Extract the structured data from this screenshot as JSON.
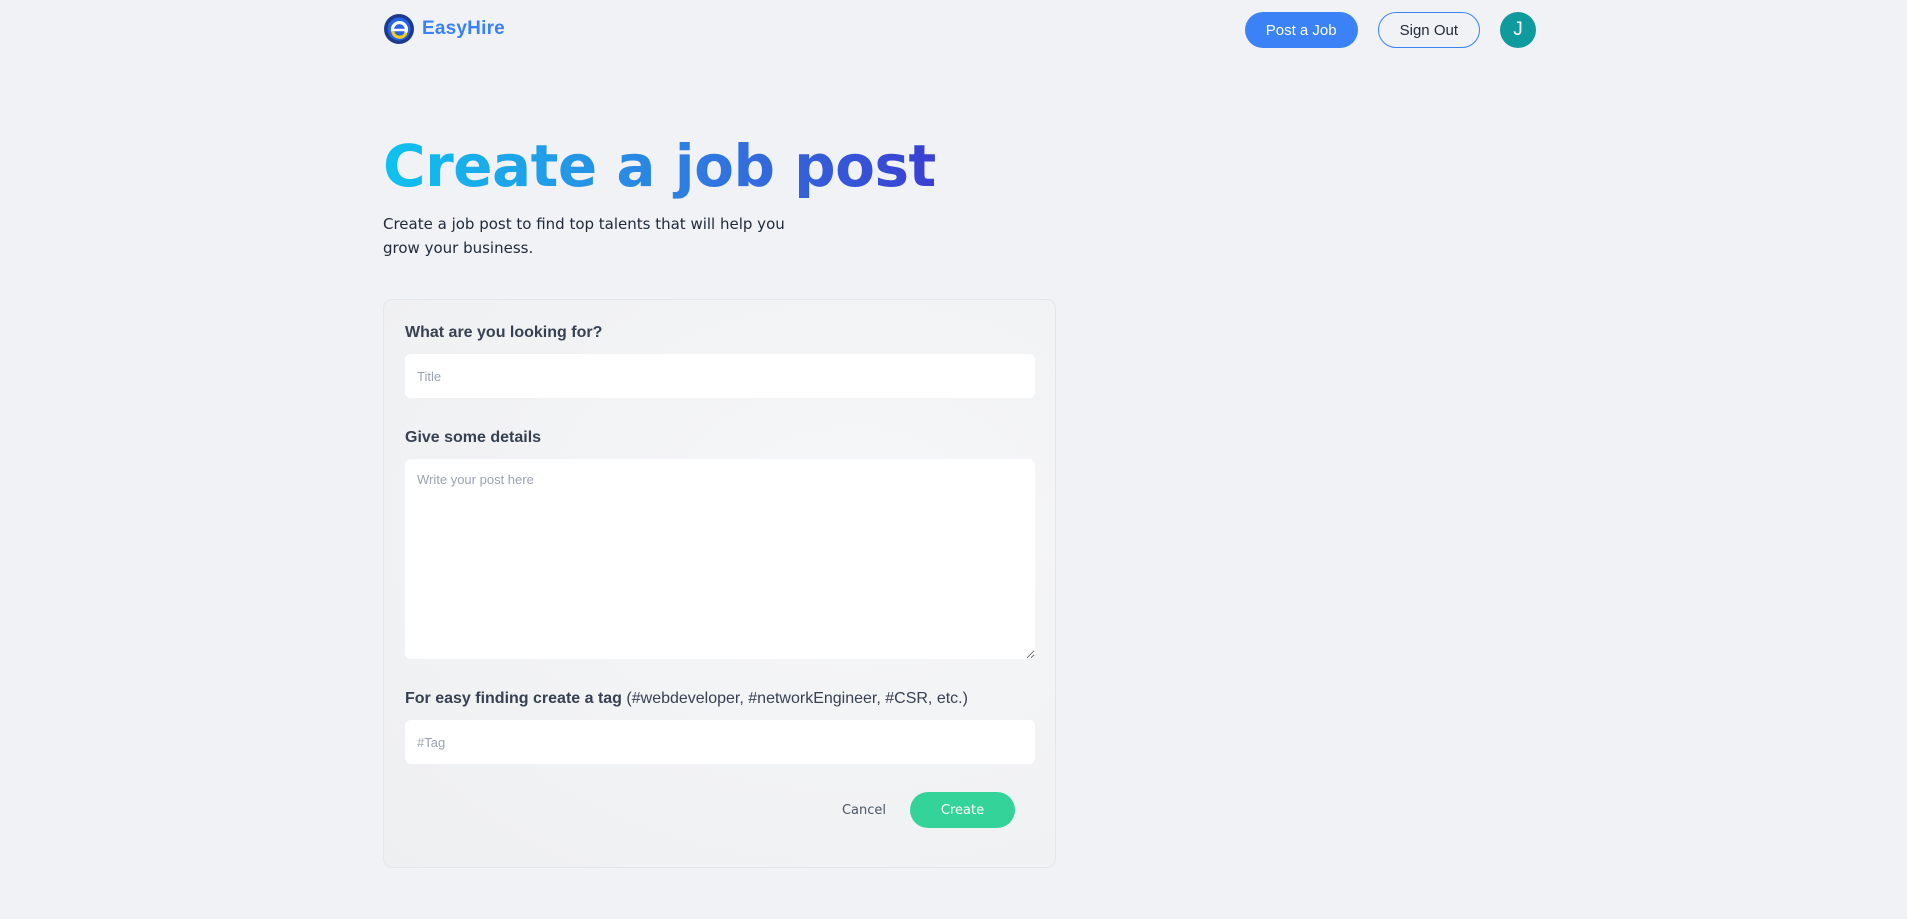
{
  "header": {
    "brand_name": "EasyHire",
    "post_job_label": "Post a Job",
    "sign_out_label": "Sign Out",
    "avatar_initial": "J"
  },
  "page": {
    "title": "Create a job post",
    "subtitle": "Create a job post to find top talents that will help you grow your business."
  },
  "form": {
    "title_label": "What are you looking for?",
    "title_value": "",
    "title_placeholder": "Title",
    "details_label": "Give some details",
    "details_value": "",
    "details_placeholder": "Write your post here",
    "tag_label": "For easy finding create a tag",
    "tag_hint": "(#webdeveloper, #networkEngineer, #CSR, etc.)",
    "tag_value": "",
    "tag_placeholder": "#Tag",
    "cancel_label": "Cancel",
    "create_label": "Create"
  },
  "colors": {
    "accent": "#3b82f6",
    "create_button": "#34d399",
    "avatar": "#0f9a9e",
    "title_gradient_start": "#0fc2ef",
    "title_gradient_end": "#3a3fd2"
  },
  "icons": {
    "brand_logo": "easyhire-logo-icon"
  }
}
